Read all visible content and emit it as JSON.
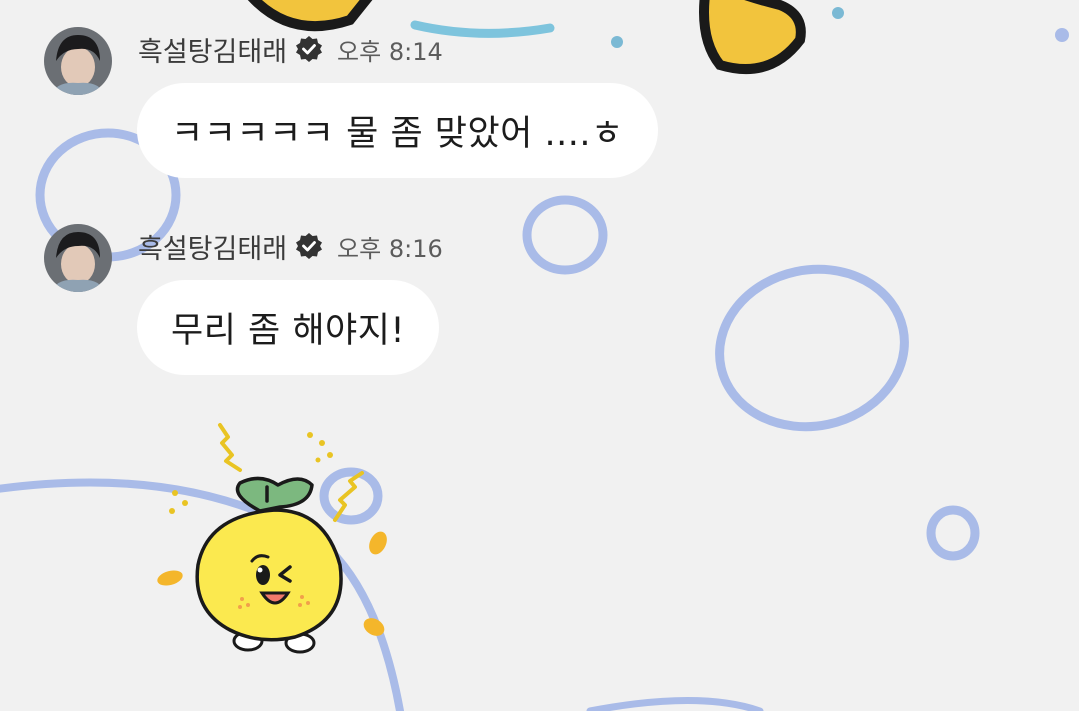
{
  "chat": {
    "messages": [
      {
        "sender": "흑설탕김태래",
        "verified_icon": "verified-badge-icon",
        "time": "오후 8:14",
        "text": "ㅋㅋㅋㅋㅋ 물 좀 맞았어 ....ㅎ"
      },
      {
        "sender": "흑설탕김태래",
        "verified_icon": "verified-badge-icon",
        "time": "오후 8:16",
        "text": "무리 좀 해야지!"
      }
    ],
    "sticker": {
      "icon": "yellow-citrus-character-sticker"
    }
  },
  "colors": {
    "background": "#f1f1f1",
    "bubble": "#ffffff",
    "bubble_text": "#1c1c1c",
    "sender_name": "#3b3b3b",
    "timestamp": "#5c5c5c",
    "decor_circles": "#9fb3e3",
    "sticker_yellow": "#fbe94f",
    "sticker_leaf": "#7cb87f"
  }
}
